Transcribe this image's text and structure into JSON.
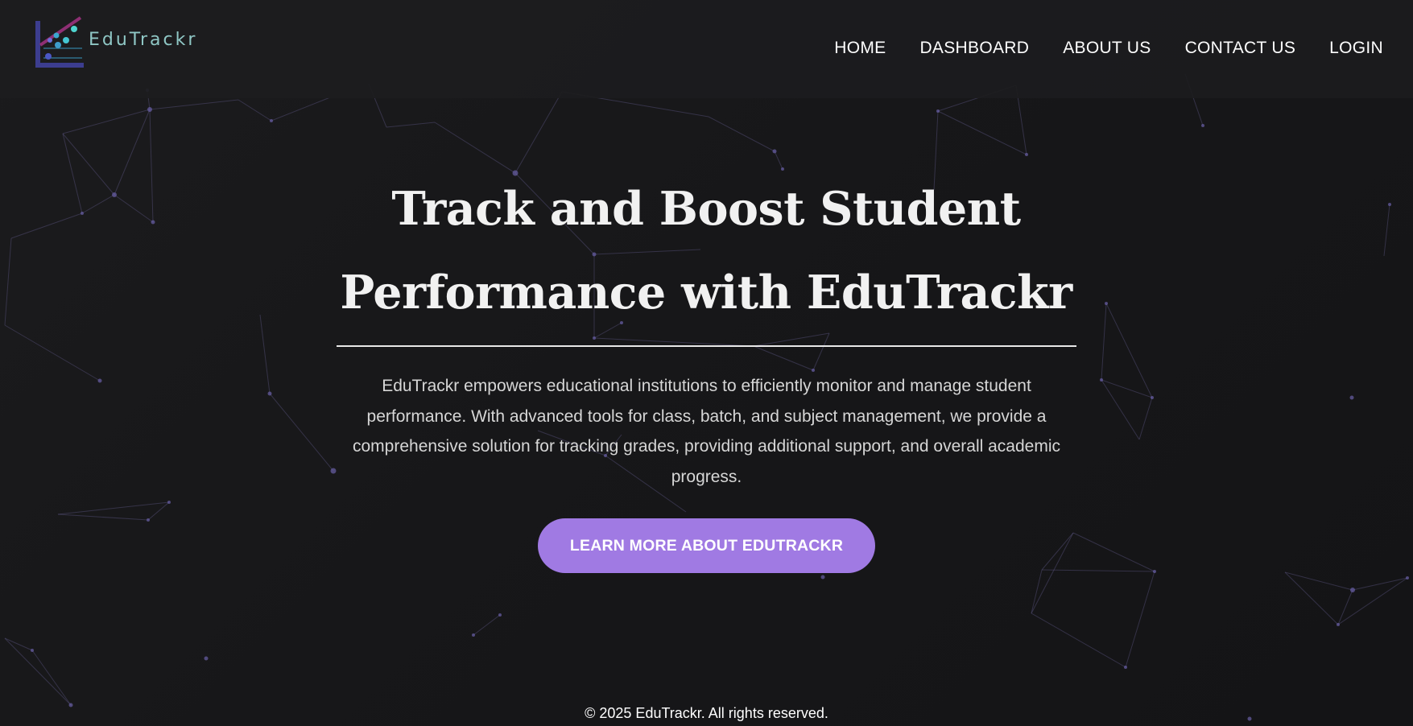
{
  "brand": {
    "name": "EduTrackr",
    "logo_icon": "chart-logo-icon",
    "colors": {
      "accent": "#a07ae3",
      "logo_text": "#8fc7c5",
      "background": "#161618"
    }
  },
  "nav": {
    "items": [
      {
        "label": "HOME"
      },
      {
        "label": "DASHBOARD"
      },
      {
        "label": "ABOUT US"
      },
      {
        "label": "CONTACT US"
      },
      {
        "label": "LOGIN"
      }
    ]
  },
  "hero": {
    "title_line1": "Track and Boost Student",
    "title_line2": "Performance with EduTrackr",
    "description": "EduTrackr empowers educational institutions to efficiently monitor and manage student performance. With advanced tools for class, batch, and subject management, we provide a comprehensive solution for tracking grades, providing additional support, and overall academic progress.",
    "cta_label": "LEARN MORE ABOUT EDUTRACKR"
  },
  "footer": {
    "text": "© 2025 EduTrackr. All rights reserved."
  }
}
